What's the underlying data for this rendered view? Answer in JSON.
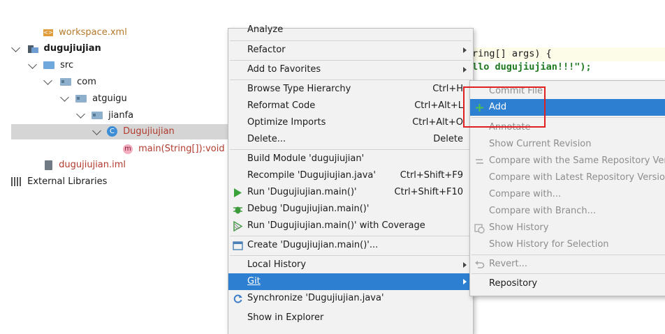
{
  "project_tree": {
    "workspace_file": "workspace.xml",
    "module": "dugujiujian",
    "src": "src",
    "com": "com",
    "atguigu": "atguigu",
    "jianfa": "jianfa",
    "class": "Dugujiujian",
    "method": "main(String[]):void",
    "iml": "dugujiujian.iml",
    "external_libraries": "External Libraries",
    "class_icon_letter": "C",
    "method_icon_letter": "m"
  },
  "editor": {
    "line1": "ring[] args) {",
    "line2": "llo dugujiujian!!!\");"
  },
  "context_menu": {
    "items": [
      {
        "label": "Analyze",
        "shortcut": ""
      },
      {
        "label": "Refactor",
        "shortcut": ""
      },
      {
        "label": "Add to Favorites",
        "shortcut": ""
      },
      {
        "label": "Browse Type Hierarchy",
        "shortcut": "Ctrl+H"
      },
      {
        "label": "Reformat Code",
        "shortcut": "Ctrl+Alt+L"
      },
      {
        "label": "Optimize Imports",
        "shortcut": "Ctrl+Alt+O"
      },
      {
        "label": "Delete...",
        "shortcut": "Delete"
      },
      {
        "label": "Build Module 'dugujiujian'",
        "shortcut": ""
      },
      {
        "label": "Recompile 'Dugujiujian.java'",
        "shortcut": "Ctrl+Shift+F9"
      },
      {
        "label": "Run 'Dugujiujian.main()'",
        "shortcut": "Ctrl+Shift+F10"
      },
      {
        "label": "Debug 'Dugujiujian.main()'",
        "shortcut": ""
      },
      {
        "label": "Run 'Dugujiujian.main()' with Coverage",
        "shortcut": ""
      },
      {
        "label": "Create 'Dugujiujian.main()'...",
        "shortcut": ""
      },
      {
        "label": "Local History",
        "shortcut": ""
      },
      {
        "label": "Git",
        "shortcut": ""
      },
      {
        "label": "Synchronize 'Dugujiujian.java'",
        "shortcut": ""
      },
      {
        "label": "Show in Explorer",
        "shortcut": ""
      }
    ]
  },
  "git_submenu": {
    "items": [
      {
        "label": "Commit File",
        "state": "disabled"
      },
      {
        "label": "Add",
        "state": "active"
      },
      {
        "label": "Annotate",
        "state": "disabled"
      },
      {
        "label": "Show Current Revision",
        "state": "disabled"
      },
      {
        "label": "Compare with the Same Repository Version",
        "state": "disabled"
      },
      {
        "label": "Compare with Latest Repository Version",
        "state": "disabled"
      },
      {
        "label": "Compare with...",
        "state": "disabled"
      },
      {
        "label": "Compare with Branch...",
        "state": "disabled"
      },
      {
        "label": "Show History",
        "state": "disabled"
      },
      {
        "label": "Show History for Selection",
        "state": "disabled"
      },
      {
        "label": "Revert...",
        "state": "disabled"
      },
      {
        "label": "Repository",
        "state": "enabled"
      }
    ]
  },
  "colors": {
    "accent": "#2d7fd1",
    "highlight_box": "#e02020",
    "selection": "#d5d5d5",
    "menu_bg": "#f2f2f2"
  }
}
